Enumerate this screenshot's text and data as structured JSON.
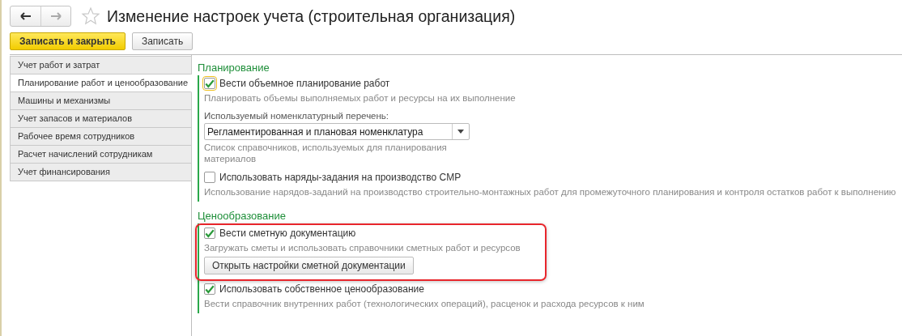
{
  "window": {
    "title": "Изменение настроек учета (строительная организация)"
  },
  "toolbar": {
    "buttons": [
      {
        "label": "Записать и закрыть",
        "kind": "primary"
      },
      {
        "label": "Записать",
        "kind": "normal"
      }
    ]
  },
  "sidebar": {
    "items": [
      {
        "label": "Учет работ и затрат",
        "selected": false
      },
      {
        "label": "Планирование работ и ценообразование",
        "selected": true
      },
      {
        "label": "Машины и механизмы",
        "selected": false
      },
      {
        "label": "Учет запасов и материалов",
        "selected": false
      },
      {
        "label": "Рабочее время сотрудников",
        "selected": false
      },
      {
        "label": "Расчет начислений сотрудникам",
        "selected": false
      },
      {
        "label": "Учет финансирования",
        "selected": false
      }
    ]
  },
  "groups": [
    {
      "title": "Планирование",
      "items": [
        {
          "kind": "checkbox",
          "label": "Вести объемное планирование работ",
          "checked": true,
          "focused": true,
          "highlighted": false,
          "hint": "Планировать объемы выполняемых работ и ресурсы на их выполнение"
        },
        {
          "kind": "select",
          "label": "Используемый номенклатурный перечень:",
          "value": "Регламентированная и плановая номенклатура",
          "hint": "Список справочников, используемых для планирования материалов"
        },
        {
          "kind": "checkbox",
          "label": "Использовать наряды-задания на производство СМР",
          "checked": false,
          "focused": false,
          "highlighted": false,
          "hint": "Использование нарядов-заданий на производство строительно-монтажных работ для промежуточного планирования и контроля остатков работ к выполнению"
        }
      ]
    },
    {
      "title": "Ценообразование",
      "items": [
        {
          "kind": "checkbox",
          "label": "Вести сметную документацию",
          "checked": true,
          "focused": false,
          "highlighted": true,
          "hint": "Загружать сметы и использовать справочники сметных работ и ресурсов",
          "button": "Открыть настройки сметной документации"
        },
        {
          "kind": "checkbox",
          "label": "Использовать собственное ценообразование",
          "checked": true,
          "focused": false,
          "highlighted": false,
          "hint": "Вести справочник внутренних работ (технологических операций), расценок и расхода ресурсов к ним"
        }
      ]
    }
  ]
}
